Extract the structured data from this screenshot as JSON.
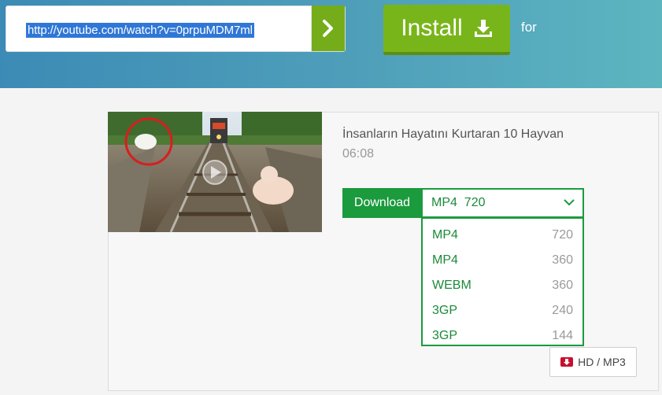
{
  "search": {
    "url_value": "http://youtube.com/watch?v=0prpuMDM7ml"
  },
  "header": {
    "install_label": "Install",
    "for_label": "for"
  },
  "video": {
    "title": "İnsanların Hayatını Kurtaran 10 Hayvan",
    "duration": "06:08"
  },
  "download": {
    "label": "Download",
    "selected": "MP4  720",
    "options": [
      {
        "format": "MP4",
        "quality": "720"
      },
      {
        "format": "MP4",
        "quality": "360"
      },
      {
        "format": "WEBM",
        "quality": "360"
      },
      {
        "format": "3GP",
        "quality": "240"
      },
      {
        "format": "3GP",
        "quality": "144"
      }
    ]
  },
  "hd_button": {
    "label": "HD / MP3"
  },
  "colors": {
    "accent_green": "#1c9a3e",
    "install_green": "#78b51a",
    "header_blue": "#3c8bb6",
    "url_highlight": "#2f77d6"
  },
  "icons": {
    "go": "chevron-right-icon",
    "install": "download-tray-icon",
    "select": "chevron-down-icon",
    "hd": "download-badge-icon",
    "thumb_overlay": "play-icon"
  }
}
